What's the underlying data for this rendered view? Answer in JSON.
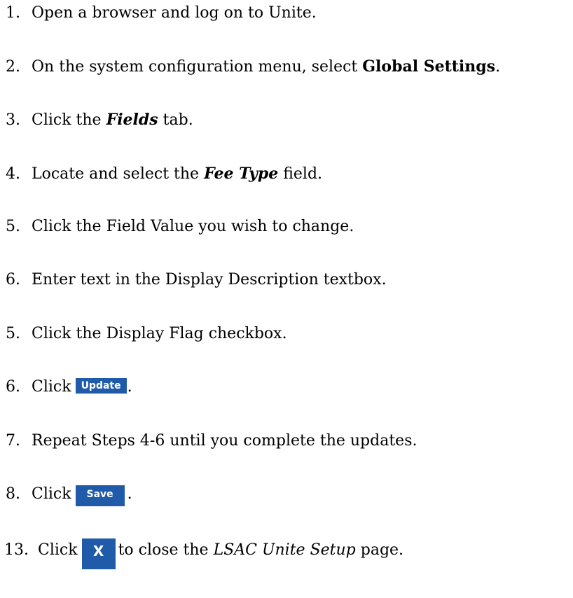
{
  "steps": [
    {
      "num": "1.",
      "text": "Open a browser and log on to Unite."
    },
    {
      "num": "2.",
      "pre": "On the system configuration menu, select ",
      "bold": "Global Settings",
      "post": "."
    },
    {
      "num": "3.",
      "pre": "Click the ",
      "bolditalic": "Fields",
      "post": " tab."
    },
    {
      "num": "4.",
      "pre": "Locate and select the ",
      "bolditalic": "Fee Type",
      "post": " field."
    },
    {
      "num": "5.",
      "text": "Click the Field Value you wish to change."
    },
    {
      "num": "6.",
      "text": "Enter text in the Display Description textbox."
    },
    {
      "num": "5.",
      "text": "Click the Display Flag checkbox."
    },
    {
      "num": "6.",
      "pre": "Click",
      "button": "Update",
      "post": "."
    },
    {
      "num": "7.",
      "text": "Repeat Steps 4-6 until you complete the updates."
    },
    {
      "num": "8.",
      "pre": "Click",
      "button": "Save",
      "post": "."
    },
    {
      "num": "13.",
      "pre": "Click",
      "button": "X",
      "mid": "to close the ",
      "italic": "LSAC Unite Setup",
      "post": " page."
    }
  ]
}
